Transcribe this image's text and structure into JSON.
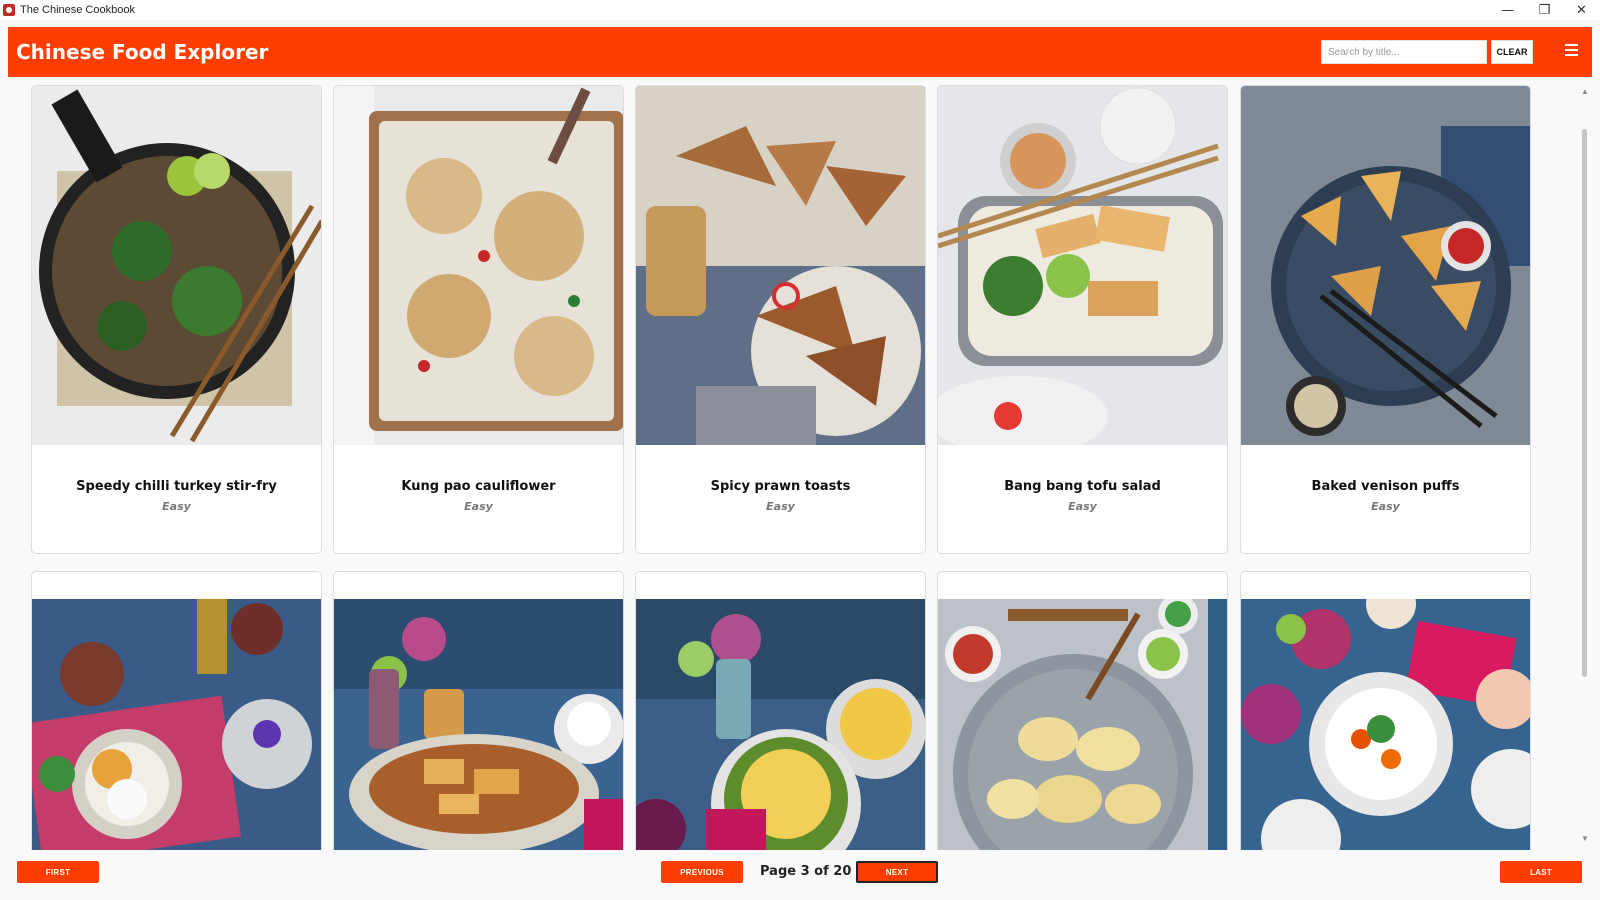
{
  "window": {
    "title": "The Chinese Cookbook",
    "minimize_glyph": "—",
    "restore_glyph": "❐",
    "close_glyph": "✕"
  },
  "header": {
    "title": "Chinese Food Explorer",
    "search_placeholder": "Search by title...",
    "clear_label": "CLEAR",
    "menu_icon": "hamburger-menu-icon",
    "accent_color": "#ff3d00"
  },
  "recipes": [
    {
      "name": "Speedy chilli turkey stir-fry",
      "difficulty": "Easy"
    },
    {
      "name": "Kung pao cauliflower",
      "difficulty": "Easy"
    },
    {
      "name": "Spicy prawn toasts",
      "difficulty": "Easy"
    },
    {
      "name": "Bang bang tofu salad",
      "difficulty": "Easy"
    },
    {
      "name": "Baked venison puffs",
      "difficulty": "Easy"
    }
  ],
  "pagination": {
    "first_label": "FIRST",
    "previous_label": "PREVIOUS",
    "page_info": "Page 3 of 20",
    "next_label": "NEXT",
    "last_label": "LAST"
  },
  "scrollbar": {
    "up_glyph": "▲",
    "down_glyph": "▼"
  }
}
